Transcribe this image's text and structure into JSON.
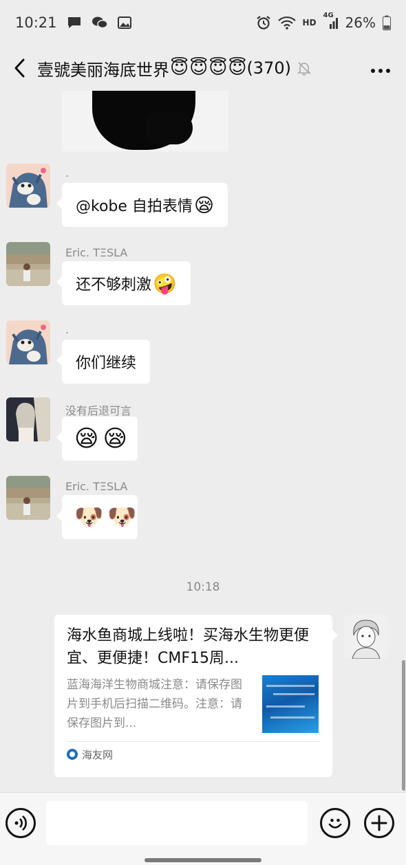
{
  "status_bar": {
    "time": "10:21",
    "network_label": "HD",
    "signal_label": "4G",
    "battery": "26%",
    "left_icons": [
      "message-icon",
      "wechat-icon",
      "gallery-icon"
    ],
    "right_icons": [
      "alarm-icon",
      "wifi-icon",
      "signal-icon",
      "battery-icon"
    ]
  },
  "header": {
    "title": "壹號美丽海底世界",
    "title_emojis": [
      "😇",
      "😇",
      "😇",
      "😇"
    ],
    "member_count": "(370)",
    "icons": [
      "back-icon",
      "mute-bell-icon",
      "more-icon"
    ]
  },
  "messages": [
    {
      "sender": ".",
      "text": "@kobe 自拍表情",
      "emoji": "😪",
      "avatar": "tom-cat-avatar"
    },
    {
      "sender": "Eric. TΞSLA",
      "text": "还不够刺激",
      "emoji": "🤪",
      "avatar": "crowd-photo-avatar"
    },
    {
      "sender": ".",
      "text": "你们继续",
      "emoji": "",
      "avatar": "tom-cat-avatar"
    },
    {
      "sender": "没有后退可言",
      "stickers": [
        "😪",
        "😪"
      ],
      "avatar": "anime-girl-avatar"
    },
    {
      "sender": "Eric. TΞSLA",
      "stickers": [
        "🐶",
        "🐶"
      ],
      "avatar": "crowd-photo-avatar"
    }
  ],
  "timestamp": "10:18",
  "link_card": {
    "title": "海水鱼商城上线啦！买海水生物更便宜、更便捷！CMF15周...",
    "description": "蓝海海洋生物商城注意：请保存图片到手机后扫描二维码。注意：请保存图片到...",
    "source": "海友网"
  },
  "input_bar": {
    "placeholder": "",
    "icons": [
      "voice-icon",
      "emoji-icon",
      "plus-icon"
    ]
  },
  "colors": {
    "background": "#ededed",
    "bubble": "#ffffff",
    "text": "#111111",
    "secondary_text": "#8a8a8a"
  }
}
